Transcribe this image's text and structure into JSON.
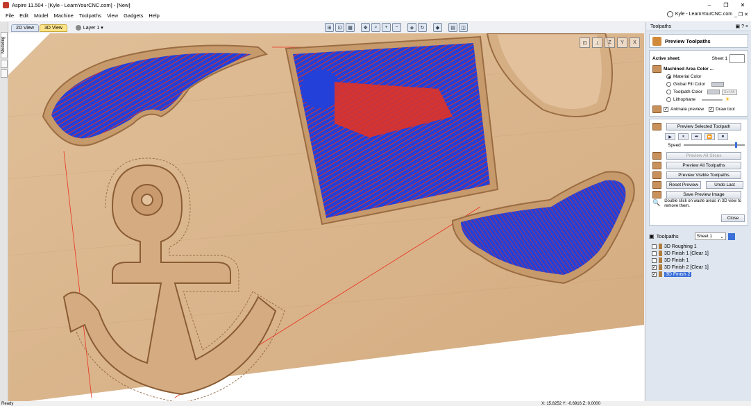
{
  "window": {
    "title": "Aspire 11.504 - [Kyle - LearnYourCNC.com] - [New]",
    "controls": [
      "–",
      "❐",
      "✕"
    ]
  },
  "menu": {
    "items": [
      "File",
      "Edit",
      "Model",
      "Machine",
      "Toolpaths",
      "View",
      "Gadgets",
      "Help"
    ],
    "user_label": "Kyle - LearnYourCNC.com",
    "sub_controls": "_ ❐ ✕"
  },
  "view_bar": {
    "tabs": [
      "2D View",
      "3D View"
    ],
    "active_tab": "3D View",
    "layer": "Layer 1 ▾"
  },
  "left_strip": {
    "modeling_tab": "Modeling"
  },
  "axis_gizmo": [
    "⊡",
    "⊥",
    "Z",
    "Y",
    "X"
  ],
  "right_panel": {
    "panel_title": "Toolpaths",
    "panel_controls": "▣ ? ×",
    "header_title": "Preview Toolpaths",
    "active_sheet_label": "Active sheet:",
    "active_sheet_value": "Sheet 1",
    "machined_area_title": "Machined Area Color ...",
    "color_options": [
      "Material Color",
      "Global Fill Color",
      "Toolpath Color",
      "Lithophane"
    ],
    "selected_color_option": "Material Color",
    "set_all_label": "Set All",
    "animate_preview": "Animate preview",
    "draw_tool": "Draw tool",
    "preview_selected": "Preview Selected Toolpath",
    "player_buttons": [
      "▶",
      "⏸",
      "⏭",
      "⏩",
      "⏹"
    ],
    "speed_label": "Speed",
    "speed_fraction": 0.84,
    "preview_all_slices": "Preview All Slices",
    "preview_all": "Preview All Toolpaths",
    "preview_visible": "Preview Visible Toolpaths",
    "reset_preview": "Reset Preview",
    "undo_last": "Undo Last",
    "save_preview_image": "Save Preview Image",
    "hint": "Double click on waste areas in 3D view to remove them.",
    "close": "Close"
  },
  "toolpaths_list": {
    "title": "Toolpaths",
    "sheet": "Sheet 1",
    "items": [
      {
        "name": "3D Roughing 1",
        "checked": false,
        "selected": false
      },
      {
        "name": "3D Finish 1 [Clear 1]",
        "checked": false,
        "selected": false
      },
      {
        "name": "3D Finish 1",
        "checked": false,
        "selected": false
      },
      {
        "name": "3D Finish 2 [Clear 1]",
        "checked": true,
        "selected": false
      },
      {
        "name": "3D Finish 2",
        "checked": true,
        "selected": true
      }
    ]
  },
  "status": {
    "ready": "Ready",
    "coords": "X: 15.8252 Y: -0.6916 Z: 0.0000"
  },
  "colors": {
    "wood": "#dcb48c",
    "pocket_blue": "#2340d8",
    "toolpath_red": "#e8321e",
    "selection": "#3a6fd8"
  }
}
